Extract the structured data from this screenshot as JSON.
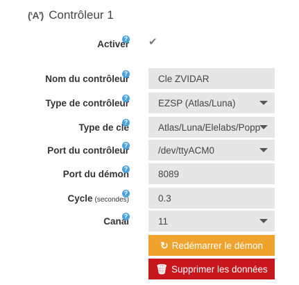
{
  "panel": {
    "title": "Contrôleur 1",
    "icon": "antenna-icon"
  },
  "form": {
    "activate": {
      "label": "Activer",
      "checked": true
    },
    "name": {
      "label": "Nom du contrôleur",
      "value": "Cle ZVIDAR"
    },
    "type": {
      "label": "Type de contrôleur",
      "value": "EZSP (Atlas/Luna)"
    },
    "key_type": {
      "label": "Type de clé",
      "value": "Atlas/Luna/Elelabs/Popp"
    },
    "port": {
      "label": "Port du contrôleur",
      "value": "/dev/ttyACM0"
    },
    "daemon_port": {
      "label": "Port du démon",
      "value": "8089"
    },
    "cycle": {
      "label": "Cycle",
      "unit": "(secondes)",
      "value": "0.3"
    },
    "channel": {
      "label": "Canal",
      "value": "11"
    }
  },
  "buttons": {
    "restart": "Redémarrer le démon",
    "delete": "Supprimer les données"
  },
  "colors": {
    "help": "#4aa3df",
    "restart": "#f0a32c",
    "delete": "#c8161d",
    "field": "#e6e6e6"
  }
}
